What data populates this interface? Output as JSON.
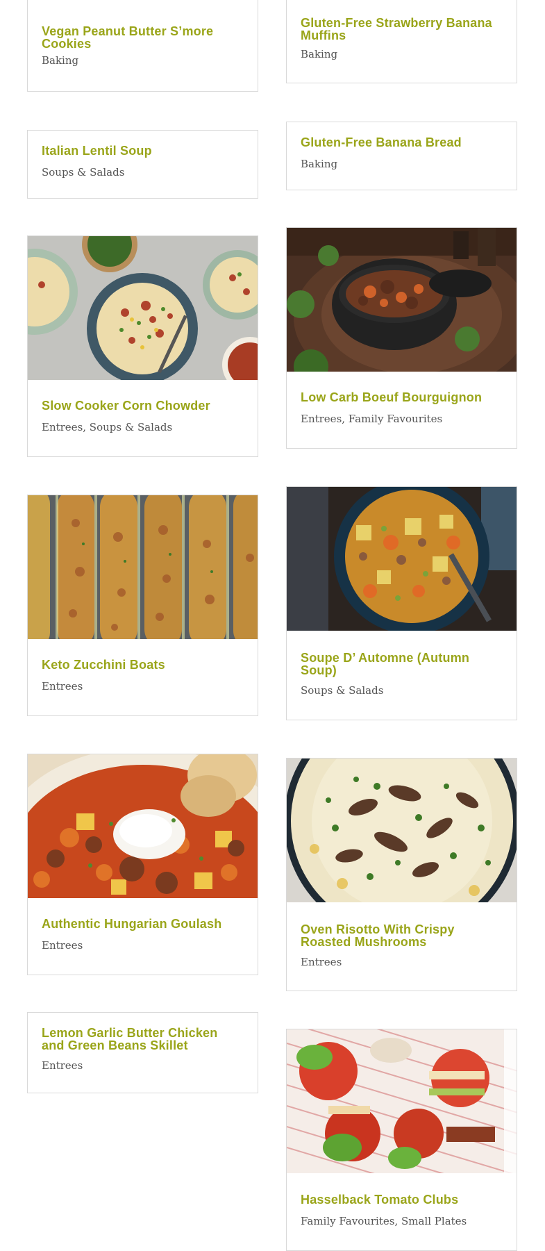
{
  "cards": [
    {
      "title": "Vegan Peanut Butter S’more Cookies",
      "categories": "Baking"
    },
    {
      "title": "Gluten-Free Strawberry Banana Muffins",
      "categories": "Baking"
    },
    {
      "title": "Italian Lentil Soup",
      "categories": "Soups & Salads"
    },
    {
      "title": "Gluten-Free Banana Bread",
      "categories": "Baking"
    },
    {
      "title": "Slow Cooker Corn Chowder",
      "categories": "Entrees, Soups & Salads",
      "image": "corn-chowder-photo"
    },
    {
      "title": "Low Carb Boeuf Bourguignon",
      "categories": "Entrees, Family Favourites",
      "image": "boeuf-bourguignon-photo"
    },
    {
      "title": "Keto Zucchini Boats",
      "categories": "Entrees",
      "image": "zucchini-boats-photo"
    },
    {
      "title": "Soupe D’ Automne (Autumn Soup)",
      "categories": "Soups & Salads",
      "image": "autumn-soup-photo"
    },
    {
      "title": "Authentic Hungarian Goulash",
      "categories": "Entrees",
      "image": "goulash-photo"
    },
    {
      "title": "Oven Risotto With Crispy Roasted Mushrooms",
      "categories": "Entrees",
      "image": "risotto-photo"
    },
    {
      "title": "Lemon Garlic Butter Chicken and Green Beans Skillet",
      "categories": "Entrees"
    },
    {
      "title": "Hasselback Tomato Clubs",
      "categories": "Family Favourites, Small Plates",
      "image": "tomato-clubs-photo"
    }
  ],
  "colors": {
    "title": "#9aa51a",
    "category": "#555555",
    "border": "#d9d9d9"
  }
}
